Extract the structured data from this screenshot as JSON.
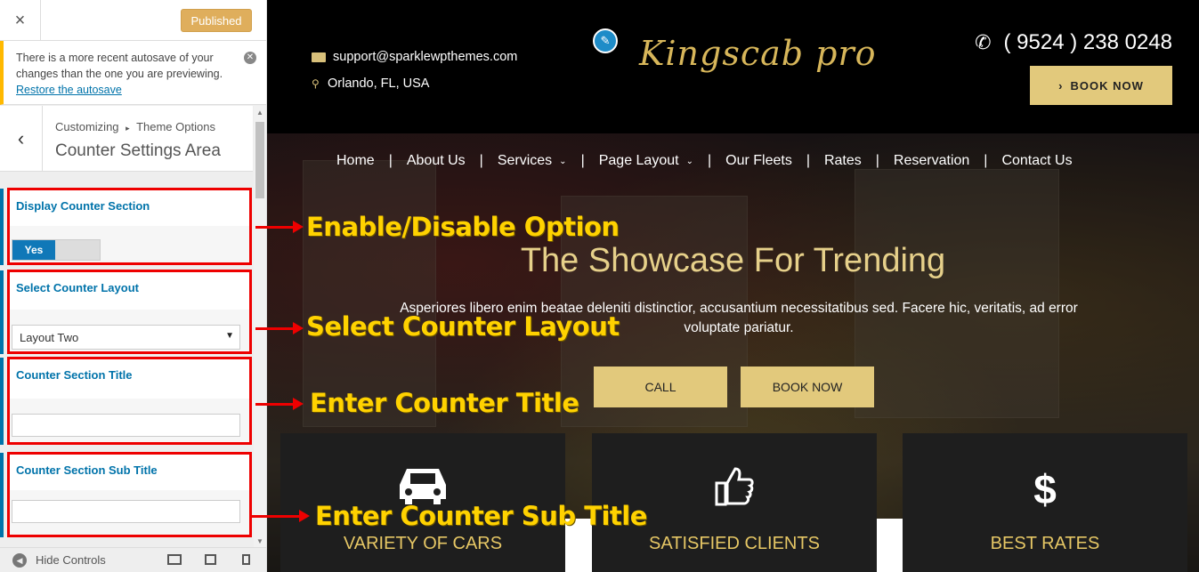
{
  "sidebar": {
    "close_glyph": "×",
    "publish_label": "Published",
    "notice": {
      "text": "There is a more recent autosave of your changes than the one you are previewing.",
      "restore_link": "Restore the autosave"
    },
    "breadcrumb": {
      "parent": "Customizing",
      "separator": "▸",
      "current_parent": "Theme Options",
      "title": "Counter Settings Area"
    },
    "controls": [
      {
        "label": "Display Counter Section",
        "toggle_value": "Yes"
      },
      {
        "label": "Select Counter Layout",
        "selected": "Layout Two"
      },
      {
        "label": "Counter Section Title",
        "value": ""
      },
      {
        "label": "Counter Section Sub Title",
        "value": ""
      }
    ],
    "footer": {
      "hide_label": "Hide Controls"
    }
  },
  "preview": {
    "email": "support@sparklewpthemes.com",
    "location": "Orlando, FL, USA",
    "logo": "Kingscab pro",
    "phone": "( 9524 ) 238 0248",
    "book_now_top": "BOOK NOW",
    "nav": [
      {
        "label": "Home",
        "has_dropdown": false
      },
      {
        "label": "About Us",
        "has_dropdown": false
      },
      {
        "label": "Services",
        "has_dropdown": true
      },
      {
        "label": "Page Layout",
        "has_dropdown": true
      },
      {
        "label": "Our Fleets",
        "has_dropdown": false
      },
      {
        "label": "Rates",
        "has_dropdown": false
      },
      {
        "label": "Reservation",
        "has_dropdown": false
      },
      {
        "label": "Contact Us",
        "has_dropdown": false
      }
    ],
    "hero": {
      "title": "The Showcase For Trending",
      "text": "Asperiores libero enim beatae deleniti distinctior, accusantium necessitatibus sed. Facere hic, veritatis, ad error voluptate pariatur.",
      "btn_call": "CALL",
      "btn_book": "BOOK NOW"
    },
    "cards": [
      {
        "icon": "car-icon",
        "label": "VARIETY OF CARS"
      },
      {
        "icon": "thumbs-up-icon",
        "label": "SATISFIED CLIENTS"
      },
      {
        "icon": "dollar-icon",
        "label": "BEST RATES"
      }
    ]
  },
  "annotations": [
    "Enable/Disable Option",
    "Select Counter Layout",
    "Enter Counter Title",
    "Enter Counter Sub Title"
  ],
  "colors": {
    "accent_gold": "#e2c97c",
    "wp_blue": "#0073aa",
    "highlight_red": "#e00000",
    "annotation_yellow": "#ffd200"
  }
}
